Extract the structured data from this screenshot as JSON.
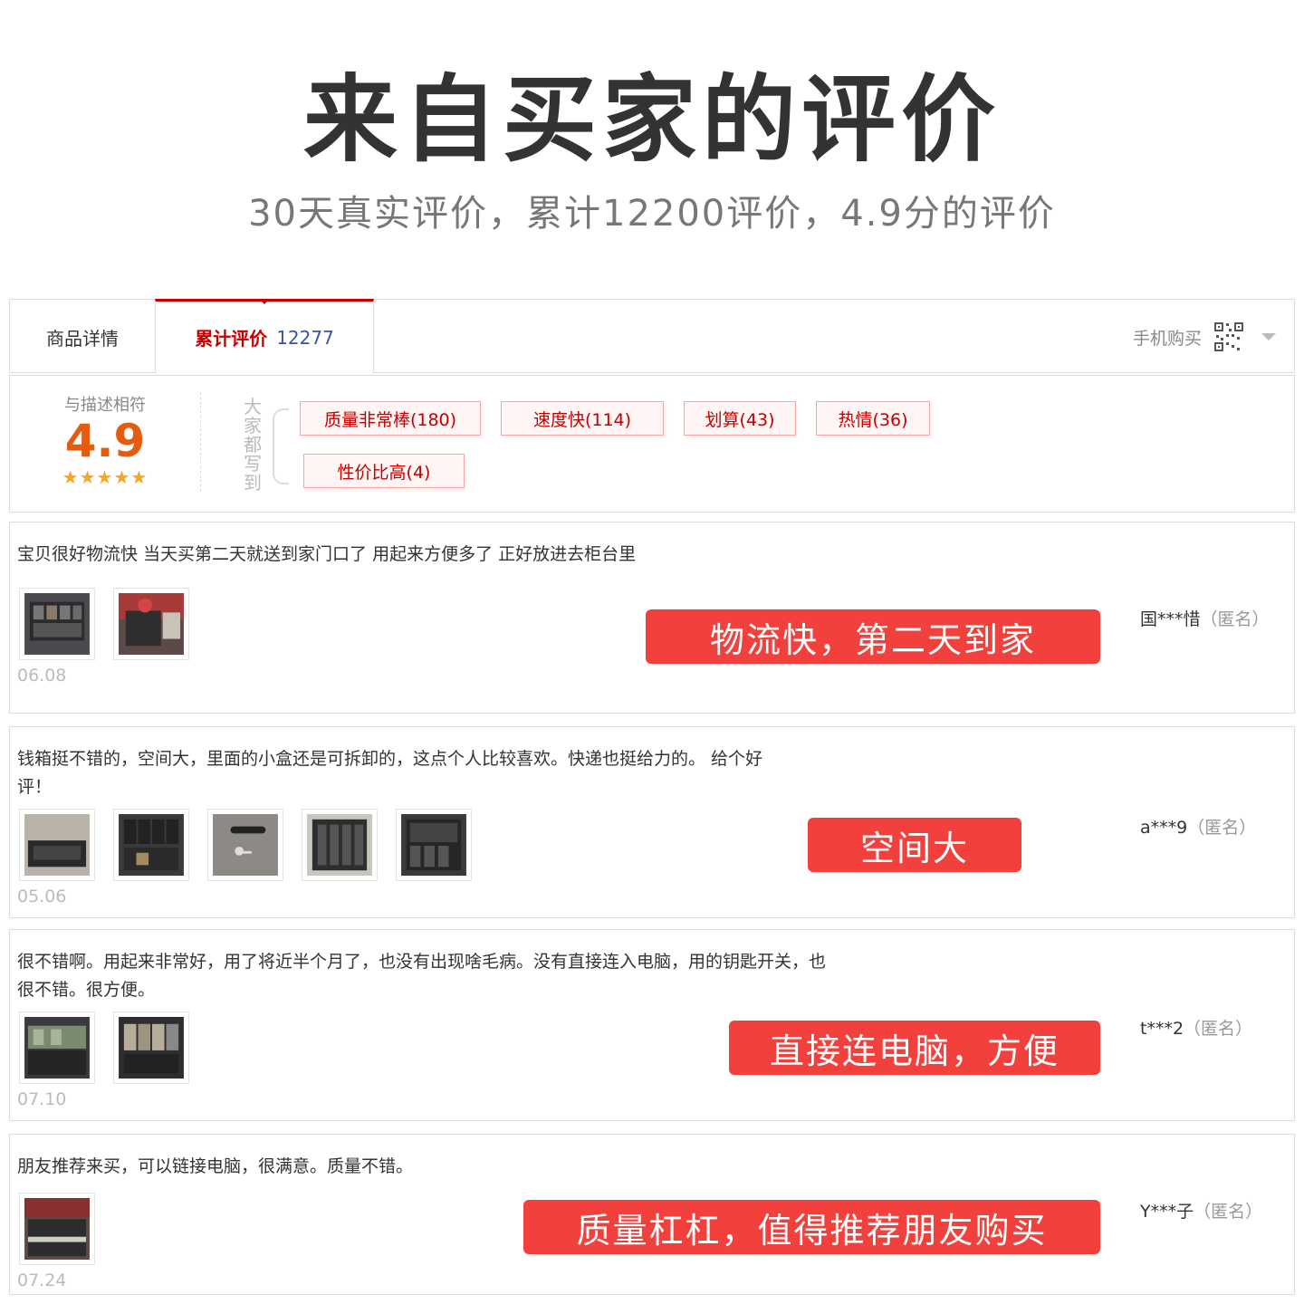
{
  "hero": {
    "title": "来自买家的评价",
    "subtitle": "30天真实评价，累计12200评价，4.9分的评价"
  },
  "tabs": {
    "detail_label": "商品详情",
    "reviews_label": "累计评价",
    "reviews_count": "12277",
    "mobile_buy_label": "手机购买"
  },
  "summary": {
    "score_label": "与描述相符",
    "score": "4.9",
    "stars": "★★★★★",
    "side_label": "大家都写到",
    "tags": [
      "质量非常棒(180)",
      "速度快(114)",
      "划算(43)",
      "热情(36)",
      "性价比高(4)"
    ]
  },
  "reviews": [
    {
      "text": "宝贝很好物流快 当天买第二天就送到家门口了 用起来方便多了 正好放进去柜台里",
      "date": "06.08",
      "banner": "物流快，第二天到家",
      "reviewer": "国***惜",
      "anon": "（匿名）"
    },
    {
      "text": "钱箱挺不错的，空间大，里面的小盒还是可拆卸的，这点个人比较喜欢。快递也挺给力的。 给个好评！",
      "date": "05.06",
      "banner": "空间大",
      "reviewer": "a***9",
      "anon": "（匿名）"
    },
    {
      "text": "很不错啊。用起来非常好，用了将近半个月了，也没有出现啥毛病。没有直接连入电脑，用的钥匙开关，也很不错。很方便。",
      "date": "07.10",
      "banner": "直接连电脑，方便",
      "reviewer": "t***2",
      "anon": "（匿名）"
    },
    {
      "text": "朋友推荐来买，可以链接电脑，很满意。质量不错。",
      "date": "07.24",
      "banner": "质量杠杠，值得推荐朋友购买",
      "reviewer": "Y***子",
      "anon": "（匿名）"
    }
  ],
  "colors": {
    "accent_red": "#c40000",
    "banner_red": "#f2403c",
    "score_orange": "#e55c0e",
    "star_gold": "#f5a623",
    "count_blue": "#3355aa"
  }
}
